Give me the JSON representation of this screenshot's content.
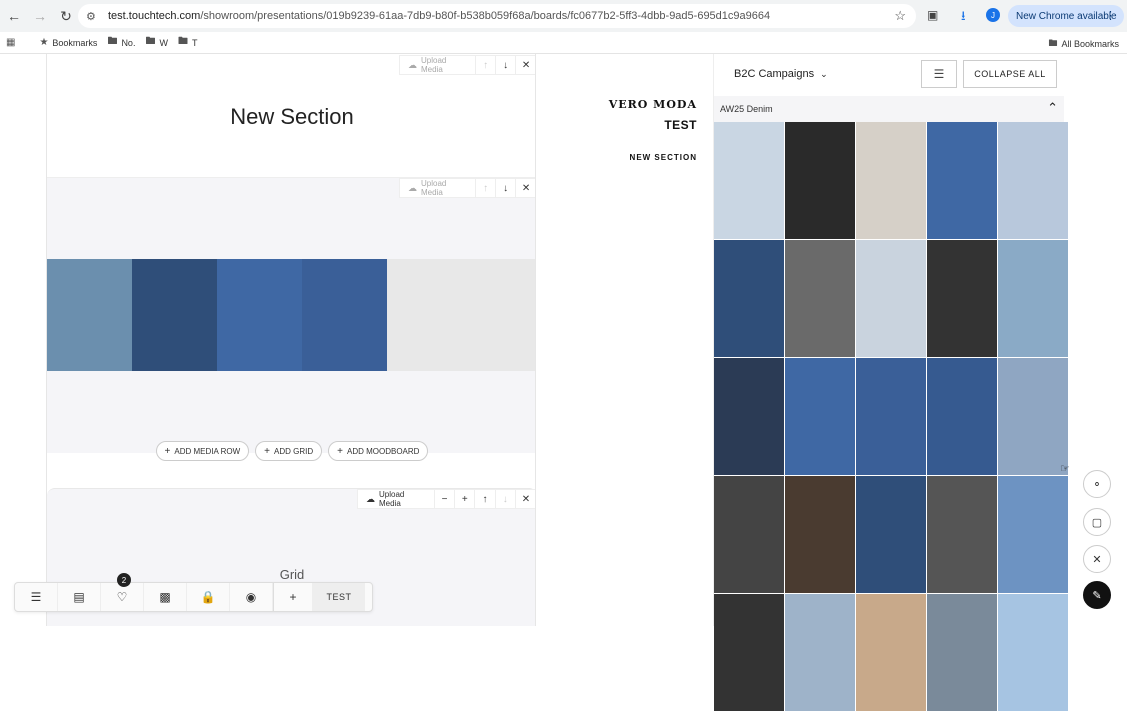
{
  "browser": {
    "url_host": "test.touchtech.com",
    "url_path": "/showroom/presentations/019b9239-61aa-7db9-b80f-b538b059f68a/boards/fc0677b2-5ff3-4dbb-9ad5-695d1c9a9664",
    "profile_initial": "J",
    "update_label": "New Chrome available",
    "bookmarks": [
      {
        "label": "Bookmarks",
        "icon": "star-icon"
      },
      {
        "label": "No.",
        "icon": "folder-icon"
      },
      {
        "label": "W",
        "icon": "folder-icon"
      },
      {
        "label": "T",
        "icon": "folder-icon"
      }
    ],
    "all_bookmarks": "All Bookmarks"
  },
  "editor": {
    "section_title": "New Section",
    "upload_media": "Upload Media",
    "controls": {
      "add_media_row": "ADD MEDIA ROW",
      "add_grid": "ADD GRID",
      "add_moodboard": "ADD MOODBOARD"
    },
    "grid_label": "Grid",
    "media_row_colors": [
      "#6b8fae",
      "#2f4e79",
      "#3f68a4",
      "#3a5f98",
      "#e8e8e8"
    ]
  },
  "preview": {
    "brand": "VERO MODA",
    "title": "TEST",
    "section": "NEW SECTION"
  },
  "media_panel": {
    "campaign": "B2C Campaigns",
    "collapse_all": "COLLAPSE ALL",
    "folder": "AW25 Denim",
    "thumb_colors": [
      "#c9d6e3",
      "#2a2a2a",
      "#d6d0c8",
      "#3f68a4",
      "#b8c8dc",
      "#2f4e79",
      "#6a6a6a",
      "#c9d3de",
      "#333333",
      "#8aaac6",
      "#2b3b55",
      "#3f68a4",
      "#3a5f98",
      "#365a90",
      "#8fa6c2",
      "#444444",
      "#4a3b30",
      "#2f4e79",
      "#555555",
      "#6d93c2",
      "#333333",
      "#9eb3c9",
      "#c8a98a",
      "#7a8a9a",
      "#a6c4e2"
    ]
  },
  "bottom_bar": {
    "favorites_count": "2",
    "test_label": "TEST"
  }
}
